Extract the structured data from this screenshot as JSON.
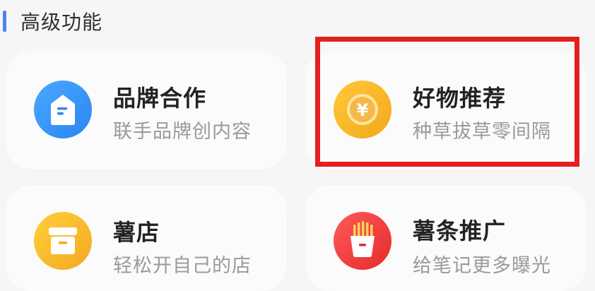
{
  "section": {
    "title": "高级功能",
    "accent_color": "#4b84f4"
  },
  "cards": [
    {
      "title": "品牌合作",
      "subtitle": "联手品牌创内容",
      "icon": "document-tag-icon",
      "icon_color": "#2b85f2"
    },
    {
      "title": "好物推荐",
      "subtitle": "种草拔草零间隔",
      "icon": "yen-coin-icon",
      "icon_color": "#f2a81a",
      "highlighted": true
    },
    {
      "title": "薯店",
      "subtitle": "轻松开自己的店",
      "icon": "store-box-icon",
      "icon_color": "#f4a820"
    },
    {
      "title": "薯条推广",
      "subtitle": "给笔记更多曝光",
      "icon": "fries-icon",
      "icon_color": "#e52b2b"
    }
  ],
  "highlight_color": "#e51e1e",
  "coin_symbol": "¥"
}
